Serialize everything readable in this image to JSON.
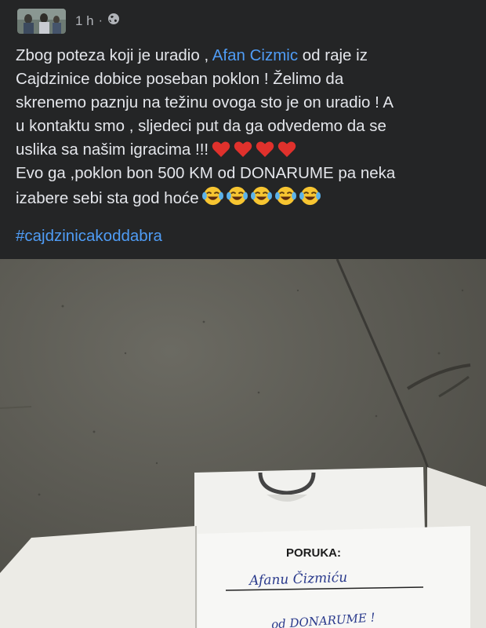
{
  "post": {
    "timestamp": "1 h",
    "separator": "·",
    "visibility_icon": "globe-icon",
    "text": {
      "l1_a": "Zbog poteza koji je uradio , ",
      "mention": "Afan Cizmic",
      "l1_b": " od raje iz",
      "l2": "Cajdzinice dobice poseban poklon ! Želimo da",
      "l3": "skrenemo paznju na težinu ovoga sto je on uradio ! A",
      "l4": "u kontaktu smo , sljedeci put da ga odvedemo da se",
      "l5": "uslika sa našim igracima !!!",
      "l6": "Evo ga ,poklon bon 500 KM od DONARUME  pa neka",
      "l7": "izabere sebi sta god hoće"
    },
    "hearts_icon": "red-heart-emoji",
    "laugh_icon": "tears-of-joy-emoji",
    "hashtag": "#cajdzinicakoddabra"
  },
  "photo": {
    "card_label": "PORUKA:",
    "handwritten_name": "Afanu Čizmiću",
    "handwritten_line2": "od DONARUME !"
  },
  "colors": {
    "background": "#242526",
    "text": "#e4e6eb",
    "link": "#4f9cf5",
    "secondary": "#b0b3b8"
  }
}
